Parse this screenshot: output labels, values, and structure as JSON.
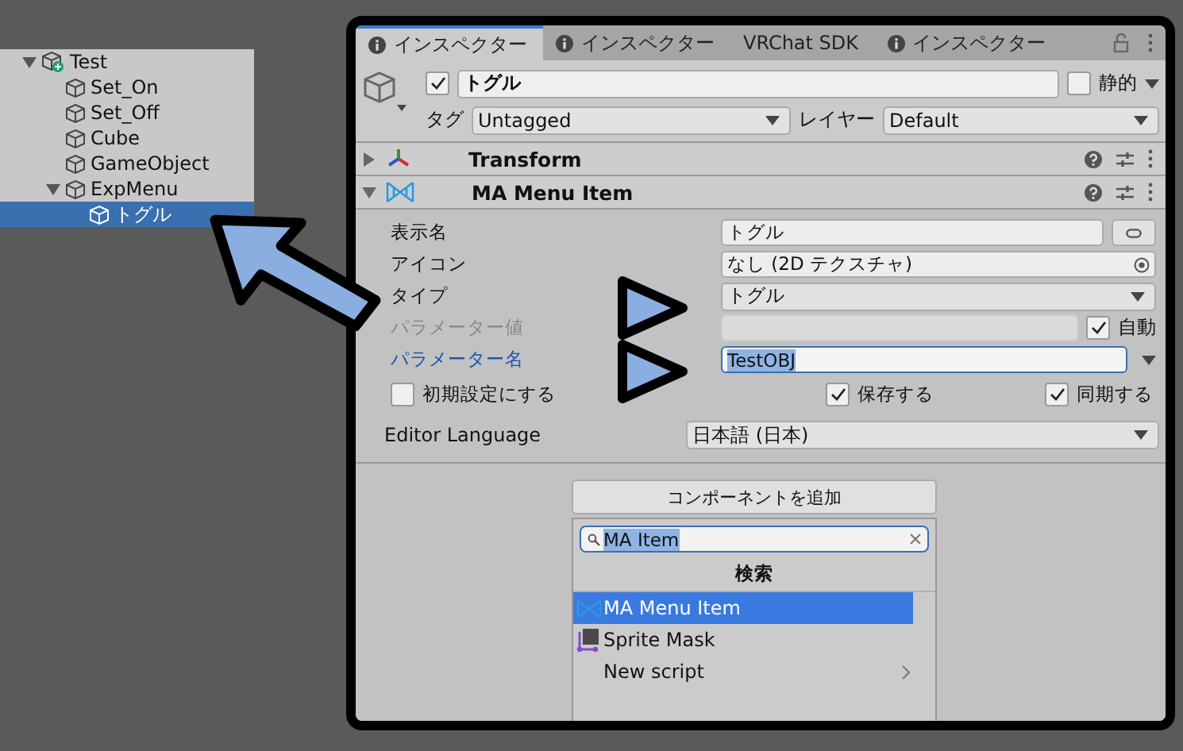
{
  "hierarchy": {
    "items": [
      {
        "label": "Test",
        "expanded": true,
        "selected": false,
        "kind": "prefab",
        "children": [
          {
            "label": "Set_On",
            "selected": false,
            "kind": "object"
          },
          {
            "label": "Set_Off",
            "selected": false,
            "kind": "object"
          },
          {
            "label": "Cube",
            "selected": false,
            "kind": "object"
          },
          {
            "label": "GameObject",
            "selected": false,
            "kind": "object"
          },
          {
            "label": "ExpMenu",
            "expanded": true,
            "selected": false,
            "kind": "object",
            "children": [
              {
                "label": "トグル",
                "selected": true,
                "kind": "object"
              }
            ]
          }
        ]
      }
    ]
  },
  "inspector": {
    "tabs": [
      {
        "label": "インスペクター",
        "selected": true,
        "kind": "info"
      },
      {
        "label": "インスペクター",
        "selected": false,
        "kind": "info"
      },
      {
        "label": "VRChat SDK",
        "selected": false,
        "kind": "plain"
      },
      {
        "label": "インスペクター",
        "selected": false,
        "kind": "info"
      }
    ],
    "object": {
      "active": true,
      "name": "トグル",
      "static": false,
      "static_label": "静的",
      "tag_label": "タグ",
      "tag": "Untagged",
      "layer_label": "レイヤー",
      "layer": "Default"
    },
    "components": [
      {
        "name": "Transform",
        "expanded": false,
        "kind": "transform"
      },
      {
        "name": "MA Menu Item",
        "expanded": true,
        "kind": "menu"
      }
    ],
    "menu_item": {
      "display_name_label": "表示名",
      "display_name": "トグル",
      "icon_label": "アイコン",
      "icon_value": "なし (2D テクスチャ)",
      "type_label": "タイプ",
      "type_value": "トグル",
      "param_value_label": "パラメーター値",
      "param_value_disabled": true,
      "auto_label": "自動",
      "auto": true,
      "param_name_label": "パラメーター名",
      "param_name": "TestOBJ",
      "default_label": "初期設定にする",
      "default": false,
      "saved_label": "保存する",
      "saved": true,
      "synced_label": "同期する",
      "synced": true
    },
    "editor_language": {
      "label": "Editor Language",
      "value": "日本語 (日本)"
    },
    "add_component": {
      "button": "コンポーネントを追加",
      "search": "MA Item",
      "heading": "検索",
      "items": [
        {
          "label": "MA Menu Item",
          "selected": true,
          "kind": "menu"
        },
        {
          "label": "Sprite Mask",
          "selected": false,
          "kind": "sprite"
        },
        {
          "label": "New script",
          "selected": false,
          "kind": "folder"
        }
      ]
    }
  }
}
